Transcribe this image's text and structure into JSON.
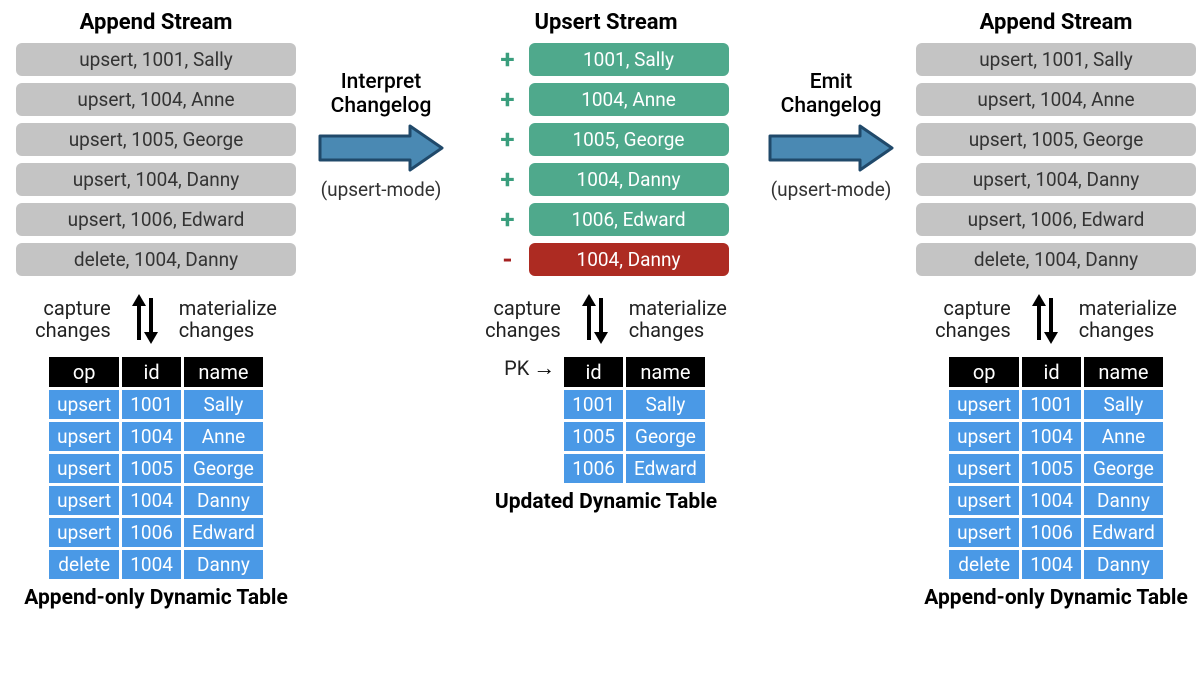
{
  "left": {
    "title": "Append Stream",
    "ops": [
      "upsert, 1001, Sally",
      "upsert, 1004, Anne",
      "upsert, 1005, George",
      "upsert, 1004, Danny",
      "upsert, 1006, Edward",
      "delete, 1004, Danny"
    ],
    "capture": "capture\nchanges",
    "materialize": "materialize\nchanges",
    "table": {
      "headers": [
        "op",
        "id",
        "name"
      ],
      "rows": [
        [
          "upsert",
          "1001",
          "Sally"
        ],
        [
          "upsert",
          "1004",
          "Anne"
        ],
        [
          "upsert",
          "1005",
          "George"
        ],
        [
          "upsert",
          "1004",
          "Danny"
        ],
        [
          "upsert",
          "1006",
          "Edward"
        ],
        [
          "delete",
          "1004",
          "Danny"
        ]
      ],
      "caption": "Append-only Dynamic Table"
    }
  },
  "interpret": {
    "label": "Interpret\nChangelog",
    "mode": "(upsert-mode)"
  },
  "middle": {
    "title": "Upsert Stream",
    "rows": [
      {
        "sign": "+",
        "text": "1001, Sally",
        "kind": "green"
      },
      {
        "sign": "+",
        "text": "1004, Anne",
        "kind": "green"
      },
      {
        "sign": "+",
        "text": "1005, George",
        "kind": "green"
      },
      {
        "sign": "+",
        "text": "1004, Danny",
        "kind": "green"
      },
      {
        "sign": "+",
        "text": "1006, Edward",
        "kind": "green"
      },
      {
        "sign": "-",
        "text": "1004, Danny",
        "kind": "red"
      }
    ],
    "capture": "capture\nchanges",
    "materialize": "materialize\nchanges",
    "pk": "PK",
    "table": {
      "headers": [
        "id",
        "name"
      ],
      "rows": [
        [
          "1001",
          "Sally"
        ],
        [
          "1005",
          "George"
        ],
        [
          "1006",
          "Edward"
        ]
      ],
      "caption": "Updated Dynamic Table"
    }
  },
  "emit": {
    "label": "Emit\nChangelog",
    "mode": "(upsert-mode)"
  },
  "right": {
    "title": "Append Stream",
    "ops": [
      "upsert, 1001, Sally",
      "upsert, 1004, Anne",
      "upsert, 1005, George",
      "upsert, 1004, Danny",
      "upsert, 1006, Edward",
      "delete, 1004, Danny"
    ],
    "capture": "capture\nchanges",
    "materialize": "materialize\nchanges",
    "table": {
      "headers": [
        "op",
        "id",
        "name"
      ],
      "rows": [
        [
          "upsert",
          "1001",
          "Sally"
        ],
        [
          "upsert",
          "1004",
          "Anne"
        ],
        [
          "upsert",
          "1005",
          "George"
        ],
        [
          "upsert",
          "1004",
          "Danny"
        ],
        [
          "upsert",
          "1006",
          "Edward"
        ],
        [
          "delete",
          "1004",
          "Danny"
        ]
      ],
      "caption": "Append-only Dynamic Table"
    }
  }
}
